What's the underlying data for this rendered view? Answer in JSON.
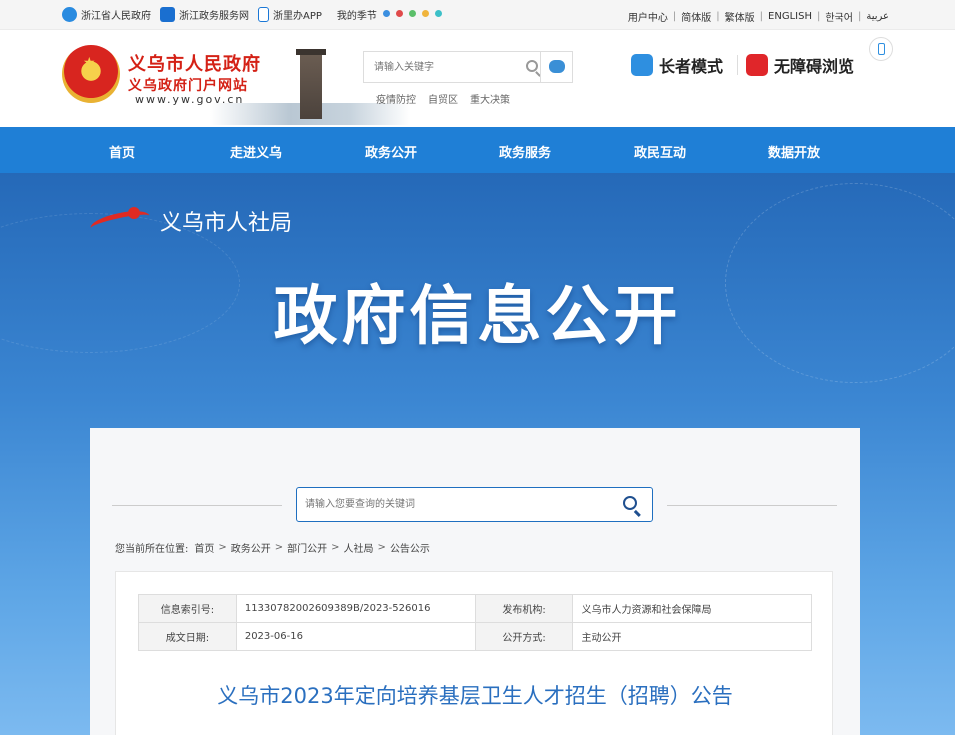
{
  "topbar": {
    "links": [
      {
        "label": "浙江省人民政府",
        "icon": "zhejiang-gov-icon"
      },
      {
        "label": "浙江政务服务网",
        "icon": "zw-service-icon"
      },
      {
        "label": "浙里办APP",
        "icon": "mobile-app-icon"
      }
    ],
    "season_label": "我的季节",
    "season_colors": [
      "#3b8fe0",
      "#e04a4a",
      "#5bbf6a",
      "#f0b43c",
      "#3cc0c8"
    ],
    "right_links": [
      "用户中心",
      "简体版",
      "繁体版",
      "ENGLISH",
      "한국어",
      "عربية"
    ]
  },
  "header": {
    "site_title": "义乌市人民政府",
    "site_subtitle": "义乌政府门户网站",
    "site_url": "www.yw.gov.cn",
    "search_placeholder": "请输入关键字",
    "hot_words": [
      "疫情防控",
      "自贸区",
      "重大决策"
    ],
    "elder_mode": "长者模式",
    "accessible_mode": "无障碍浏览"
  },
  "nav": {
    "items": [
      "首页",
      "走进义乌",
      "政务公开",
      "政务服务",
      "政民互动",
      "数据开放"
    ]
  },
  "banner": {
    "bureau_name": "义乌市人社局",
    "title": "政府信息公开"
  },
  "content": {
    "search_placeholder": "请输入您要查询的关键词",
    "breadcrumb_prefix": "您当前所在位置:",
    "breadcrumb": [
      "首页",
      "政务公开",
      "部门公开",
      "人社局",
      "公告公示"
    ],
    "meta": {
      "index_label": "信息索引号:",
      "index_value": "11330782002609389B/2023-526016",
      "org_label": "发布机构:",
      "org_value": "义乌市人力资源和社会保障局",
      "date_label": "成文日期:",
      "date_value": "2023-06-16",
      "method_label": "公开方式:",
      "method_value": "主动公开"
    },
    "doc_title": "义乌市2023年定向培养基层卫生人才招生（招聘）公告"
  }
}
